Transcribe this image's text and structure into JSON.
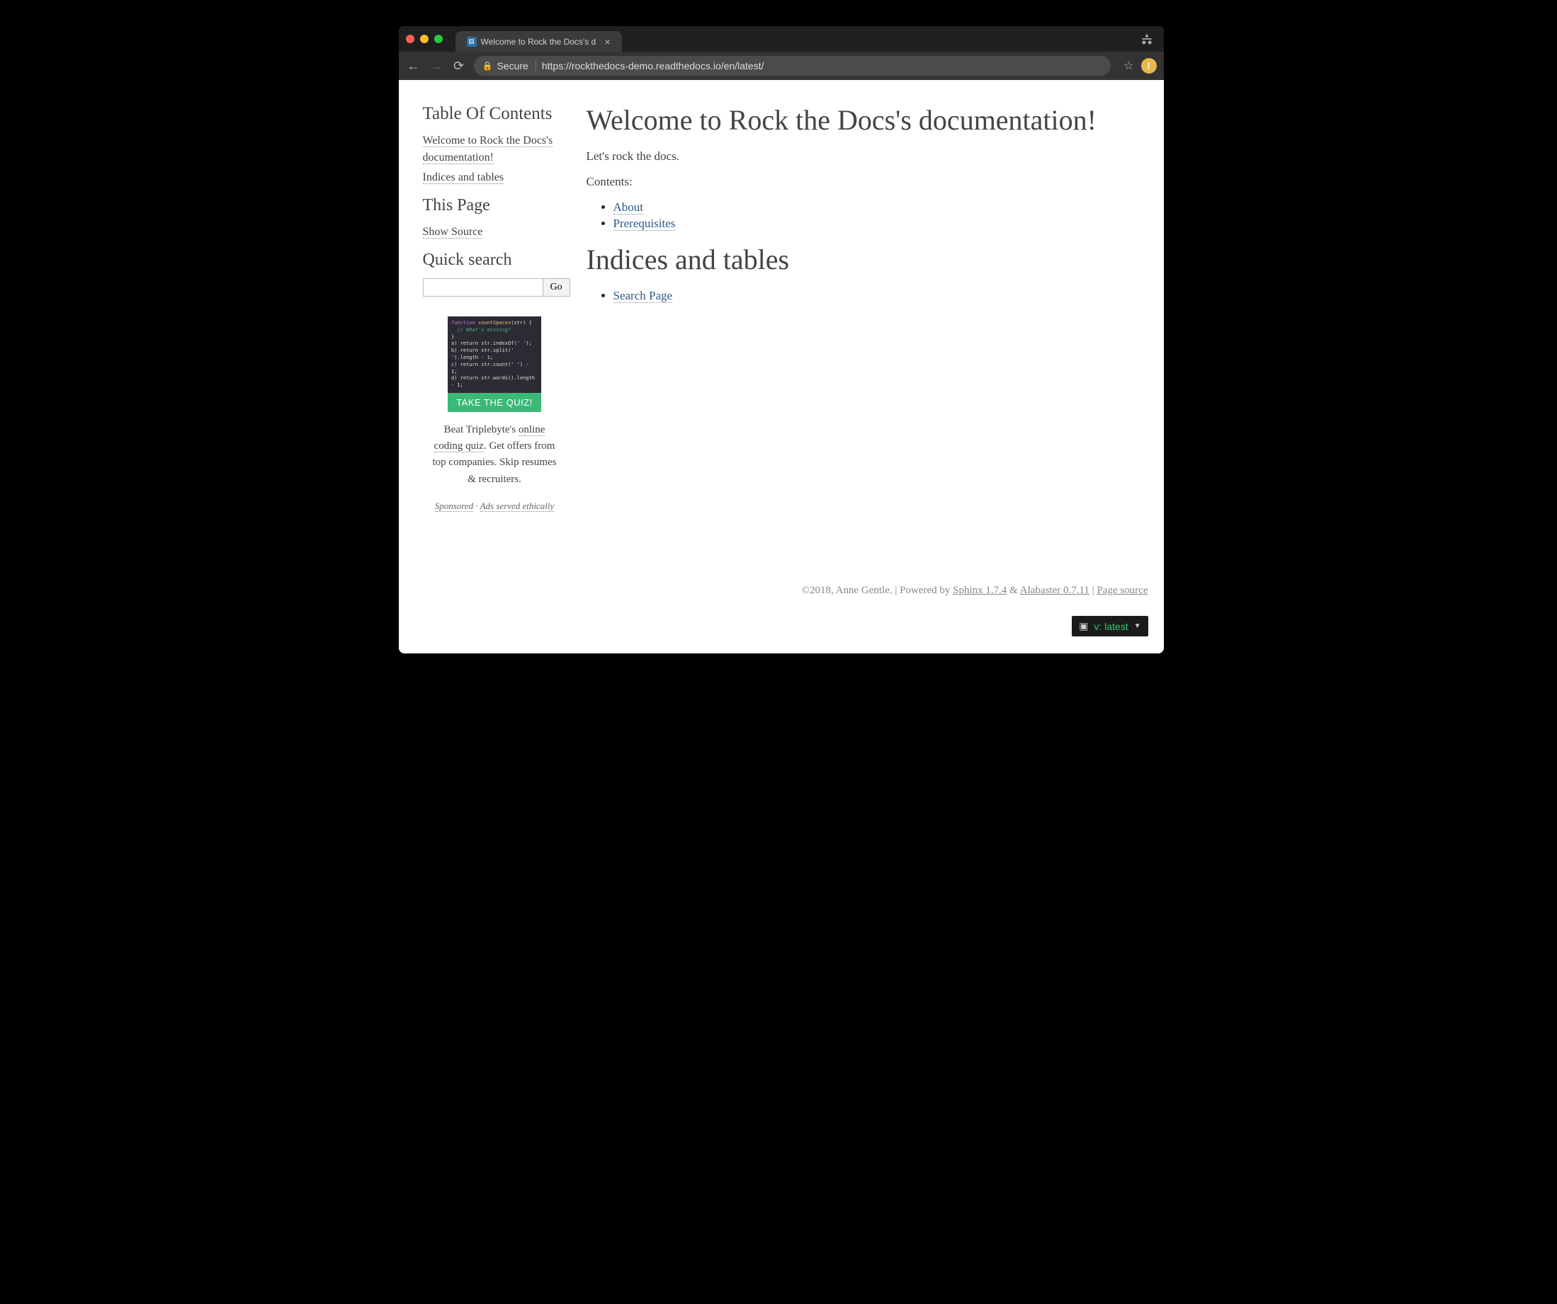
{
  "browser": {
    "tab_title": "Welcome to Rock the Docs's d",
    "secure_label": "Secure",
    "url_prefix": "https://",
    "url_rest": "rockthedocs-demo.readthedocs.io/en/latest/"
  },
  "sidebar": {
    "toc_heading": "Table Of Contents",
    "toc_links": [
      "Welcome to Rock the Docs's documentation!",
      "Indices and tables"
    ],
    "this_page_heading": "This Page",
    "show_source": "Show Source",
    "quick_search_heading": "Quick search",
    "go_label": "Go"
  },
  "ad": {
    "cta": "TAKE THE QUIZ!",
    "text_prefix": "Beat Triplebyte's ",
    "link1": "online coding quiz",
    "text_suffix": ". Get offers from top companies. Skip resumes & recruiters.",
    "sponsored": "Sponsored",
    "sep": " · ",
    "ethics": "Ads served ethically"
  },
  "main": {
    "h1": "Welcome to Rock the Docs's documentation!",
    "intro": "Let's rock the docs.",
    "contents_label": "Contents:",
    "contents_links": [
      "About",
      "Prerequisites"
    ],
    "h2": "Indices and tables",
    "index_links": [
      "Search Page"
    ]
  },
  "footer": {
    "copyright": "©2018, Anne Gentle. ",
    "sep1": "| ",
    "powered": "Powered by ",
    "sphinx": "Sphinx 1.7.4",
    "amp": " & ",
    "alabaster": "Alabaster 0.7.11",
    "sep2": " | ",
    "page_source": "Page source"
  },
  "rtd": {
    "version": "v: latest"
  }
}
